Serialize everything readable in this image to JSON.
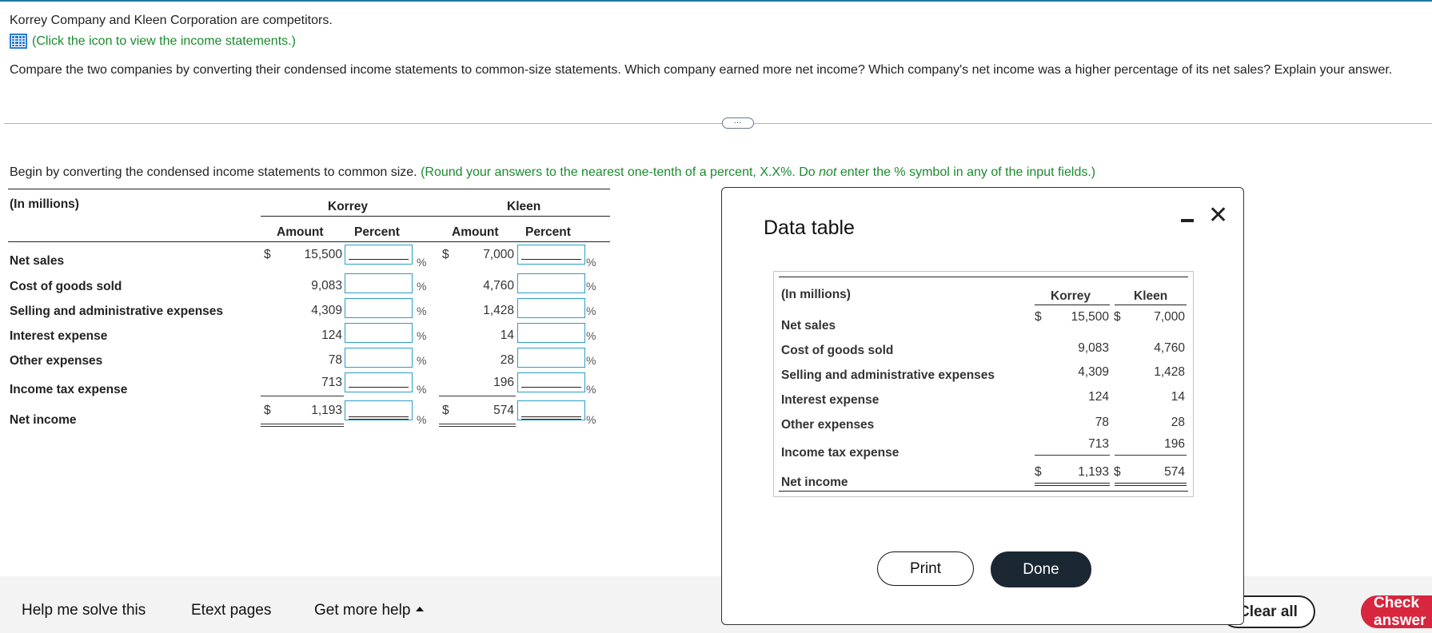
{
  "intro": "Korrey Company and Kleen Corporation are competitors.",
  "view_link": "(Click the icon to view the income statements.)",
  "question": "Compare the two companies by converting their condensed income statements to common-size statements. Which company earned more net income? Which company's net income was a higher percentage of its net sales? Explain your answer.",
  "more_button": "…",
  "instruction": {
    "main": "Begin by converting the condensed income statements to common size.",
    "hint_before": "(Round your answers to the nearest one-tenth of a percent, X.X%. Do",
    "hint_not": "not",
    "hint_after": "enter the % symbol in any of the input fields.)"
  },
  "work_table": {
    "units_label": "(In millions)",
    "korrey_header": "Korrey",
    "kleen_header": "Kleen",
    "amount_header": "Amount",
    "percent_header": "Percent",
    "dollar": "$",
    "percent_sign": "%",
    "rows": [
      {
        "label": "Net sales",
        "korrey": "15,500",
        "kleen": "7,000"
      },
      {
        "label": "Cost of goods sold",
        "korrey": "9,083",
        "kleen": "4,760"
      },
      {
        "label": "Selling and administrative expenses",
        "korrey": "4,309",
        "kleen": "1,428"
      },
      {
        "label": "Interest expense",
        "korrey": "124",
        "kleen": "14"
      },
      {
        "label": "Other expenses",
        "korrey": "78",
        "kleen": "28"
      },
      {
        "label": "Income tax expense",
        "korrey": "713",
        "kleen": "196"
      },
      {
        "label": "Net income",
        "korrey": "1,193",
        "kleen": "574"
      }
    ]
  },
  "modal": {
    "title": "Data table",
    "units_label": "(In millions)",
    "korrey_header": "Korrey",
    "kleen_header": "Kleen",
    "dollar": "$",
    "rows": [
      {
        "label": "Net sales",
        "korrey": "15,500",
        "kleen": "7,000"
      },
      {
        "label": "Cost of goods sold",
        "korrey": "9,083",
        "kleen": "4,760"
      },
      {
        "label": "Selling and administrative expenses",
        "korrey": "4,309",
        "kleen": "1,428"
      },
      {
        "label": "Interest expense",
        "korrey": "124",
        "kleen": "14"
      },
      {
        "label": "Other expenses",
        "korrey": "78",
        "kleen": "28"
      },
      {
        "label": "Income tax expense",
        "korrey": "713",
        "kleen": "196"
      },
      {
        "label": "Net income",
        "korrey": "1,193",
        "kleen": "574"
      }
    ],
    "print_label": "Print",
    "done_label": "Done",
    "close_glyph": "✕"
  },
  "footer": {
    "help": "Help me solve this",
    "etext": "Etext pages",
    "more_help": "Get more help",
    "clear_all": "Clear all",
    "check_answer": "Check answer"
  },
  "colors": {
    "accent_green": "#1b8a2e",
    "input_border": "#2a9dc8",
    "check_button": "#d7263d",
    "done_button": "#1b2733"
  }
}
